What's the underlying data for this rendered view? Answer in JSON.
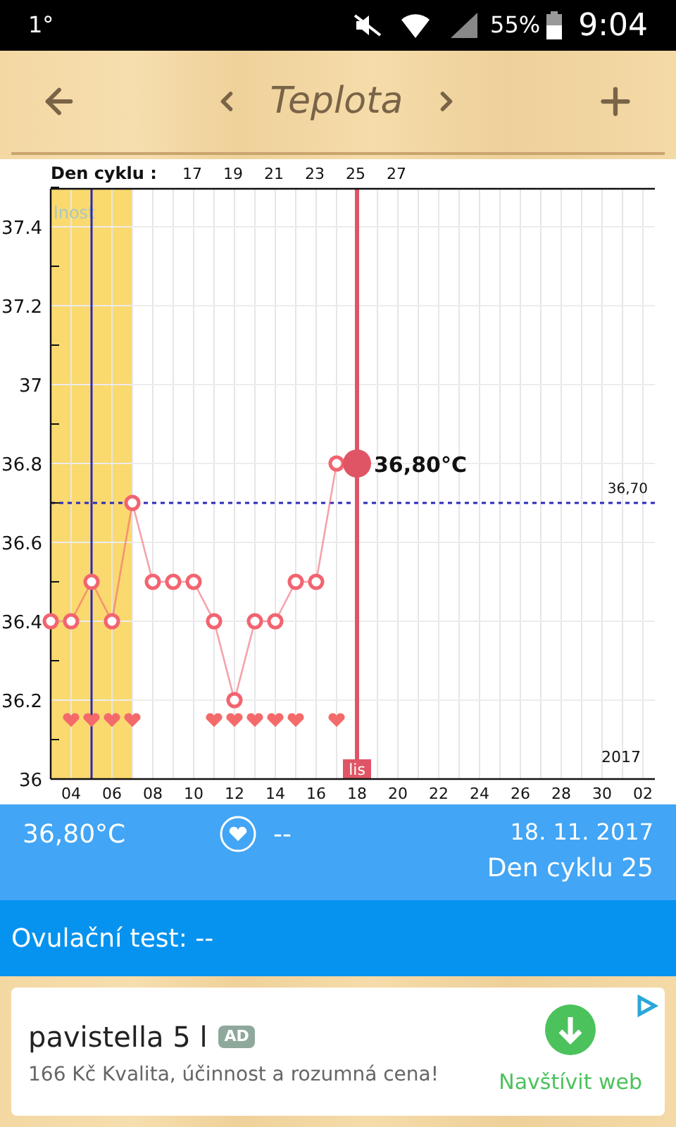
{
  "status_bar": {
    "left": "1°",
    "battery": "55%",
    "time": "9:04"
  },
  "toolbar": {
    "title": "Teplota"
  },
  "chart": {
    "fertile_window": {
      "label": "lnost",
      "color": "#fad96f"
    },
    "cycle_axis": {
      "label": "Den cyklu :",
      "ticks": [
        "17",
        "19",
        "21",
        "23",
        "25",
        "27"
      ]
    },
    "chart_data": {
      "type": "line",
      "grid": true,
      "categories": [
        null,
        "04",
        null,
        "06",
        null,
        "08",
        null,
        "10",
        null,
        "12",
        null,
        "14",
        null,
        "16",
        null,
        "18",
        null,
        "20",
        null,
        "22",
        null,
        "24",
        null,
        "26",
        null,
        "28",
        null,
        "30",
        null,
        "02"
      ],
      "series": [
        {
          "color": "#f26470",
          "marker": "circle",
          "values": [
            36.4,
            36.4,
            36.5,
            36.4,
            36.7,
            36.5,
            36.5,
            36.5,
            36.4,
            36.2,
            36.4,
            36.4,
            36.5,
            36.5,
            36.8,
            36.8,
            null,
            null,
            null,
            null,
            null,
            null,
            null,
            null,
            null,
            null,
            null,
            null,
            null,
            null
          ]
        },
        {
          "type": "scatter",
          "color": "#f46a6a",
          "values": [
            null,
            36.15,
            36.15,
            36.15,
            36.15,
            null,
            null,
            null,
            36.15,
            36.15,
            36.15,
            36.15,
            36.15,
            null,
            36.15,
            null,
            null,
            null,
            null,
            null,
            null,
            null,
            null,
            null,
            null,
            null,
            null,
            null,
            null,
            null
          ]
        }
      ],
      "ylim": [
        36,
        37.5
      ],
      "yticks": [
        {
          "value": 36,
          "label": "36"
        },
        {
          "value": 36.2,
          "label": "36.2"
        },
        {
          "value": 36.4,
          "label": "36.4"
        },
        {
          "value": 36.6,
          "label": "36.6"
        },
        {
          "value": 36.8,
          "label": "36.8"
        },
        {
          "value": 37,
          "label": "37"
        },
        {
          "value": 37.2,
          "label": "37.2"
        },
        {
          "value": 37.4,
          "label": "37.4"
        }
      ],
      "ref_lines": [
        {
          "axis": "y",
          "value": 36.7,
          "color": "#2a2ab8",
          "label": "36,70"
        },
        {
          "axis": "x",
          "value": "18",
          "color": "#e05565",
          "label": "lis"
        }
      ],
      "annotations": [
        {
          "text": "36,80°C",
          "x": "18",
          "y": 36.8
        },
        "2017"
      ]
    }
  },
  "info": {
    "temperature": "36,80°C",
    "intercourse": "--",
    "date": "18. 11. 2017",
    "cycle_day": "Den cyklu 25"
  },
  "ovulation": {
    "label": "Ovulační test: --"
  },
  "ad": {
    "title": "pavistella 5 l",
    "badge": "AD",
    "text": "166 Kč Kvalita, účinnost a rozumná cena!",
    "button": "Navštívit web"
  }
}
